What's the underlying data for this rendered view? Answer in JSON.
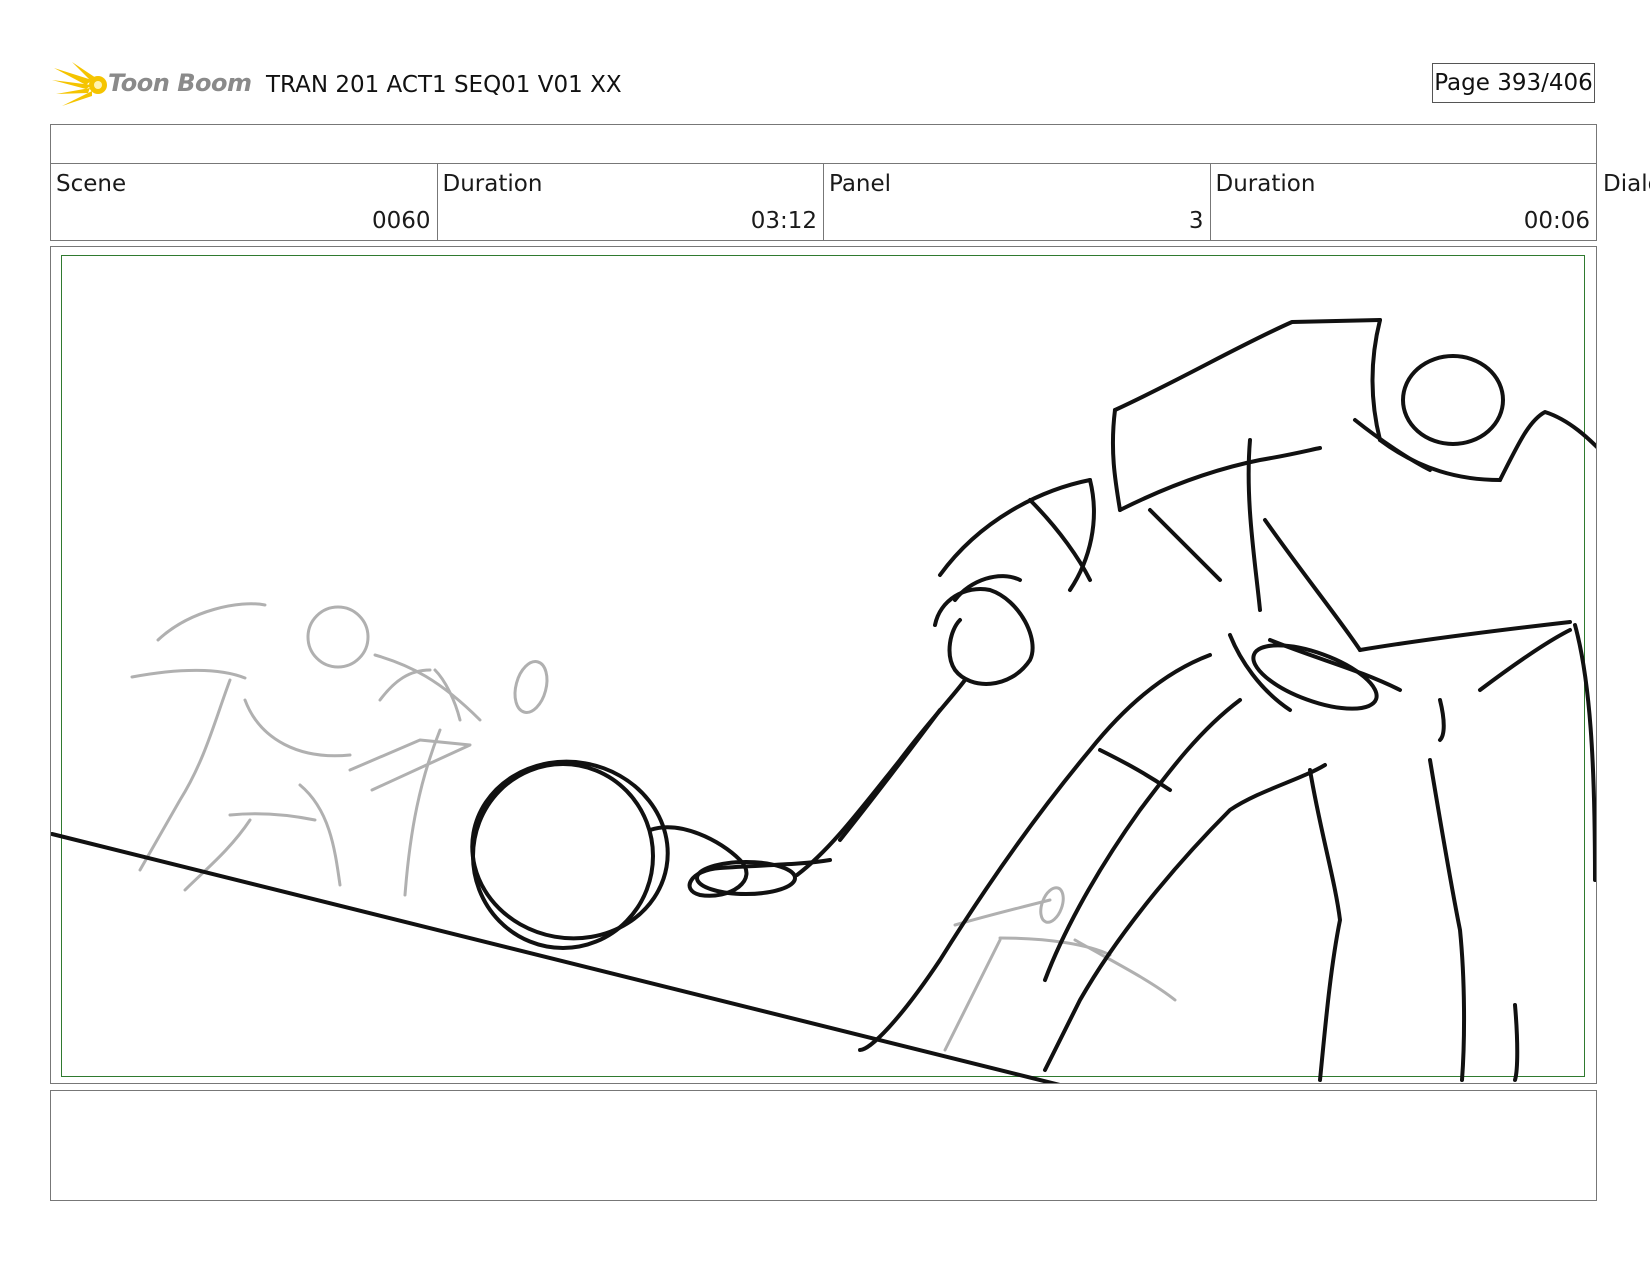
{
  "header": {
    "logo_text": "Toon Boom",
    "title": "TRAN 201 ACT1 SEQ01 V01 XX",
    "page": "Page 393/406"
  },
  "info": {
    "scene_label": "Scene",
    "scene_value": "0060",
    "scene_duration_label": "Duration",
    "scene_duration_value": "03:12",
    "panel_label": "Panel",
    "panel_value": "3",
    "panel_duration_label": "Duration",
    "panel_duration_value": "00:06",
    "dialog_label": "Dialog"
  },
  "colors": {
    "safe_frame": "#2f7a2f",
    "sketch_ink": "#111111",
    "sketch_rough": "#b0b0b0",
    "logo_star": "#f5c400"
  }
}
